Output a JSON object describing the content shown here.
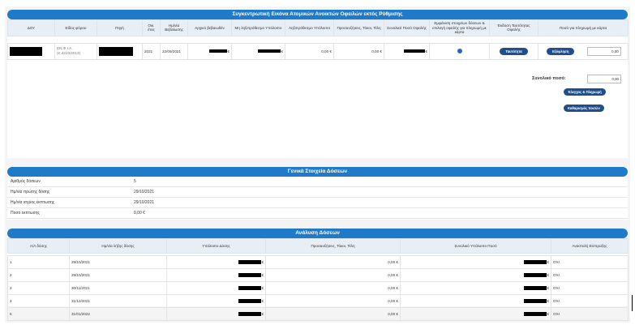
{
  "summary": {
    "title": "Συγκεντρωτική Εικόνα Ατομικών Ανοικτών Οφειλών εκτός Ρύθμισης",
    "headers": [
      "ΔΟΥ",
      "Είδος φόρου",
      "Πηγή",
      "Οικ. έτος",
      "Ημ/νία Βεβαίωσης",
      "Αρχικό βεβαιωθέν",
      "Μη ληξιπρόθεσμο Υπόλοιπο",
      "Ληξιπρόθεσμο Υπόλοιπο",
      "Προσαυξήσεις, Τόκοι, Τέλη",
      "Συνολικό Ποσό Οφειλής",
      "Εμφάνιση στοιχείων δόσεων & επιλογή οφειλής για πληρωμή με κάρτα",
      "Έκδοση Ταυτότητας Οφειλής",
      "Ποσό για πληρωμή με κάρτα"
    ],
    "row": {
      "tax_type": "ΕΝ.Φ.Ι.Α.",
      "tax_code": "(Κ.4223/2013)",
      "year": "2021",
      "date": "22/09/2021",
      "euro_a": "€",
      "euro_b": "€",
      "overdue": "0,00 €",
      "surcharges": "0,00 €",
      "euro_c": "€",
      "id_button": "Ταυτότητα",
      "clear_button": "Εξόφληση",
      "amount": "0,00"
    },
    "total_label": "Συνολικό ποσό:",
    "total_amount": "0,00",
    "check_button": "Έλεγχος & Πληρωμή",
    "clear_amounts_button": "Καθαρισμός ποσών"
  },
  "general": {
    "title": "Γενικά Στοιχεία Δόσεων",
    "rows": [
      {
        "label": "Αριθμός δόσεων",
        "value": "5"
      },
      {
        "label": "Ημ/νία πρώτης δόσης",
        "value": "29/10/2021"
      },
      {
        "label": "Ημ/νία ισχύος έκπτωσης",
        "value": "29/10/2021"
      },
      {
        "label": "Ποσό έκπτωσης",
        "value": "0,00 €"
      }
    ]
  },
  "analysis": {
    "title": "Ανάλυση Δόσεων",
    "headers": [
      "Α/Α δόσης",
      "Ημ/νία λήξης δόσης",
      "Υπόλοιπο Δόσης",
      "Προσαυξήσεις, Τόκοι, Τέλη",
      "Συνολικό Υπόλοιπο Ποσό",
      "Αναστολή Είσπραξης"
    ],
    "rows": [
      {
        "n": "1",
        "date": "29/10/2021",
        "euro": "€",
        "fees": "0,00 €",
        "euro2": "€",
        "suspend": "ΟΧΙ"
      },
      {
        "n": "2",
        "date": "29/10/2021",
        "euro": "€",
        "fees": "0,00 €",
        "euro2": "€",
        "suspend": "ΟΧΙ"
      },
      {
        "n": "3",
        "date": "30/11/2021",
        "euro": "€",
        "fees": "0,00 €",
        "euro2": "€",
        "suspend": "ΟΧΙ"
      },
      {
        "n": "4",
        "date": "31/12/2021",
        "euro": "€",
        "fees": "0,00 €",
        "euro2": "€",
        "suspend": "ΟΧΙ"
      },
      {
        "n": "5",
        "date": "31/01/2022",
        "euro": "€",
        "fees": "0,00 €",
        "euro2": "€",
        "suspend": "ΟΧΙ"
      }
    ]
  }
}
